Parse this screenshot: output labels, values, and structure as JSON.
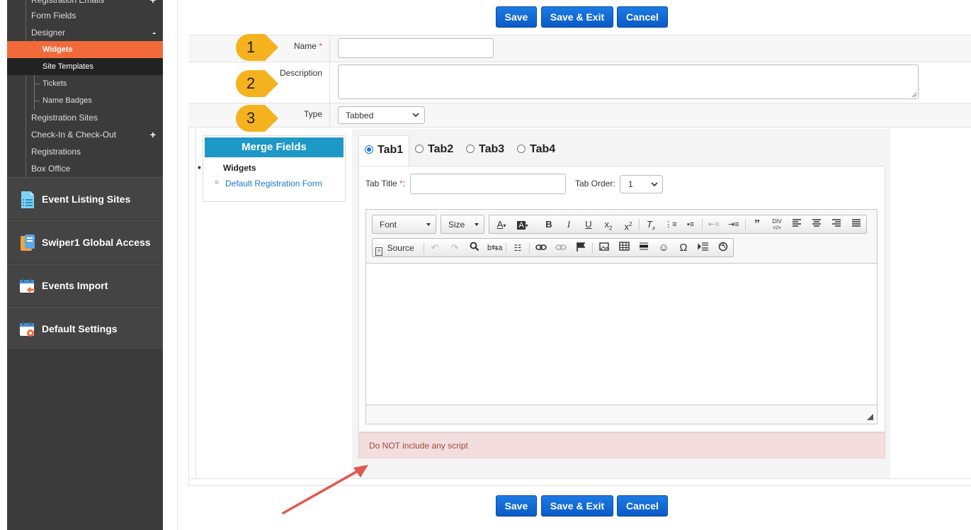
{
  "sidebar": {
    "sub_items": [
      {
        "label": "Registration Emails",
        "marker": "+"
      },
      {
        "label": "Form Fields",
        "marker": ""
      },
      {
        "label": "Designer",
        "marker": "-"
      }
    ],
    "designer_items": [
      {
        "label": "Widgets"
      },
      {
        "label": "Site Templates"
      },
      {
        "label": "Tickets"
      },
      {
        "label": "Name Badges"
      }
    ],
    "sub_items_after": [
      {
        "label": "Registration Sites",
        "marker": ""
      },
      {
        "label": "Check-In & Check-Out",
        "marker": "+"
      },
      {
        "label": "Registrations",
        "marker": ""
      },
      {
        "label": "Box Office",
        "marker": ""
      }
    ],
    "main_items": [
      {
        "label": "Event Listing Sites",
        "icon": "listing-icon"
      },
      {
        "label": "Swiper1 Global Access",
        "icon": "access-icon"
      },
      {
        "label": "Events Import",
        "icon": "import-icon"
      },
      {
        "label": "Default Settings",
        "icon": "settings-icon"
      }
    ]
  },
  "buttons": {
    "save": "Save",
    "save_exit": "Save & Exit",
    "cancel": "Cancel"
  },
  "form": {
    "name_label": "Name",
    "required_mark": "*",
    "name_value": "",
    "description_label": "Description",
    "description_value": "",
    "type_label": "Type",
    "type_value": "Tabbed"
  },
  "callouts": [
    "1",
    "2",
    "3"
  ],
  "merge_fields": {
    "title": "Merge Fields",
    "group": "Widgets",
    "link": "Default Registration Form"
  },
  "tabs": [
    "Tab1",
    "Tab2",
    "Tab3",
    "Tab4"
  ],
  "tab_title_label": "Tab Title",
  "tab_title_suffix": ":",
  "tab_order_label": "Tab Order:",
  "tab_order_value": "1",
  "editor": {
    "font_label": "Font",
    "size_label": "Size",
    "source_label": "Source"
  },
  "alert_text": "Do NOT include any script",
  "colors": {
    "accent_orange": "#f26a3b",
    "button_blue": "#0a5bc4",
    "merge_header": "#1e98c7",
    "alert_bg": "#f2dede",
    "callout": "#f5b21f",
    "arrow": "#e05a4f"
  }
}
